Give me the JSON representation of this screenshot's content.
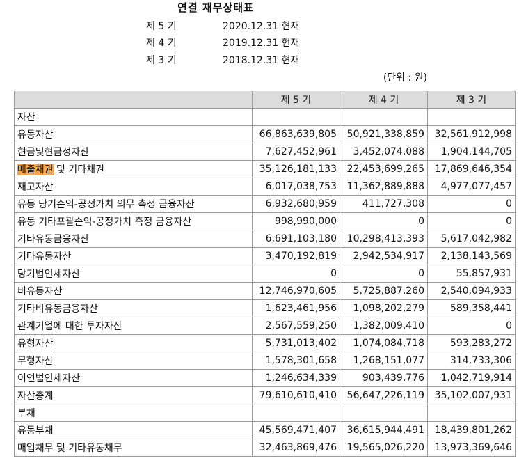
{
  "title": "연결 재무상태표",
  "periods": [
    {
      "label": "제 5 기",
      "date": "2020.12.31 현재"
    },
    {
      "label": "제 4 기",
      "date": "2019.12.31 현재"
    },
    {
      "label": "제 3 기",
      "date": "2018.12.31 현재"
    }
  ],
  "unit": "(단위 : 원)",
  "table": {
    "headers": [
      "",
      "제 5 기",
      "제 4 기",
      "제 3 기"
    ],
    "rows": [
      {
        "label": "자산",
        "level": 0,
        "values": [
          "",
          "",
          ""
        ]
      },
      {
        "label": "유동자산",
        "level": 1,
        "values": [
          "66,863,639,805",
          "50,921,338,859",
          "32,561,912,998"
        ]
      },
      {
        "label": "현금및현금성자산",
        "level": 2,
        "values": [
          "7,627,452,961",
          "3,452,074,088",
          "1,904,144,705"
        ]
      },
      {
        "label": " 및 기타채권",
        "highlight": "매출채권",
        "level": 2,
        "values": [
          "35,126,181,133",
          "22,453,699,265",
          "17,869,646,354"
        ]
      },
      {
        "label": "재고자산",
        "level": 2,
        "values": [
          "6,017,038,753",
          "11,362,889,888",
          "4,977,077,457"
        ]
      },
      {
        "label": "유동 당기손익-공정가치 의무 측정 금융자산",
        "level": 2,
        "values": [
          "6,932,680,959",
          "411,727,308",
          "0"
        ]
      },
      {
        "label": "유동 기타포괄손익-공정가치 측정 금융자산",
        "level": 2,
        "values": [
          "998,990,000",
          "0",
          "0"
        ]
      },
      {
        "label": "기타유동금융자산",
        "level": 2,
        "values": [
          "6,691,103,180",
          "10,298,413,393",
          "5,617,042,982"
        ]
      },
      {
        "label": "기타유동자산",
        "level": 2,
        "values": [
          "3,470,192,819",
          "2,942,534,917",
          "2,138,143,569"
        ]
      },
      {
        "label": "당기법인세자산",
        "level": 2,
        "values": [
          "0",
          "0",
          "55,857,931"
        ]
      },
      {
        "label": "비유동자산",
        "level": 1,
        "values": [
          "12,746,970,605",
          "5,725,887,260",
          "2,540,094,933"
        ]
      },
      {
        "label": "기타비유동금융자산",
        "level": 2,
        "values": [
          "1,623,461,956",
          "1,098,202,279",
          "589,358,441"
        ]
      },
      {
        "label": "관계기업에 대한 투자자산",
        "level": 2,
        "values": [
          "2,567,559,250",
          "1,382,009,410",
          "0"
        ]
      },
      {
        "label": "유형자산",
        "level": 2,
        "values": [
          "5,731,013,402",
          "1,074,084,718",
          "593,283,272"
        ]
      },
      {
        "label": "무형자산",
        "level": 2,
        "values": [
          "1,578,301,658",
          "1,268,151,077",
          "314,733,306"
        ]
      },
      {
        "label": "이연법인세자산",
        "level": 2,
        "values": [
          "1,246,634,339",
          "903,439,776",
          "1,042,719,914"
        ]
      },
      {
        "label": "자산총계",
        "level": 1,
        "values": [
          "79,610,610,410",
          "56,647,226,119",
          "35,102,007,931"
        ]
      },
      {
        "label": "부채",
        "level": 0,
        "values": [
          "",
          "",
          ""
        ]
      },
      {
        "label": "유동부채",
        "level": 1,
        "values": [
          "45,569,471,407",
          "36,615,944,491",
          "18,439,801,262"
        ]
      },
      {
        "label": "매입채무 및 기타유동채무",
        "level": 2,
        "values": [
          "32,463,869,476",
          "19,565,026,220",
          "13,973,369,646"
        ]
      }
    ]
  },
  "colors": {
    "header_bg": "#dcdcdc",
    "highlight": "#f7a84a",
    "border": "#9a9a9a"
  }
}
